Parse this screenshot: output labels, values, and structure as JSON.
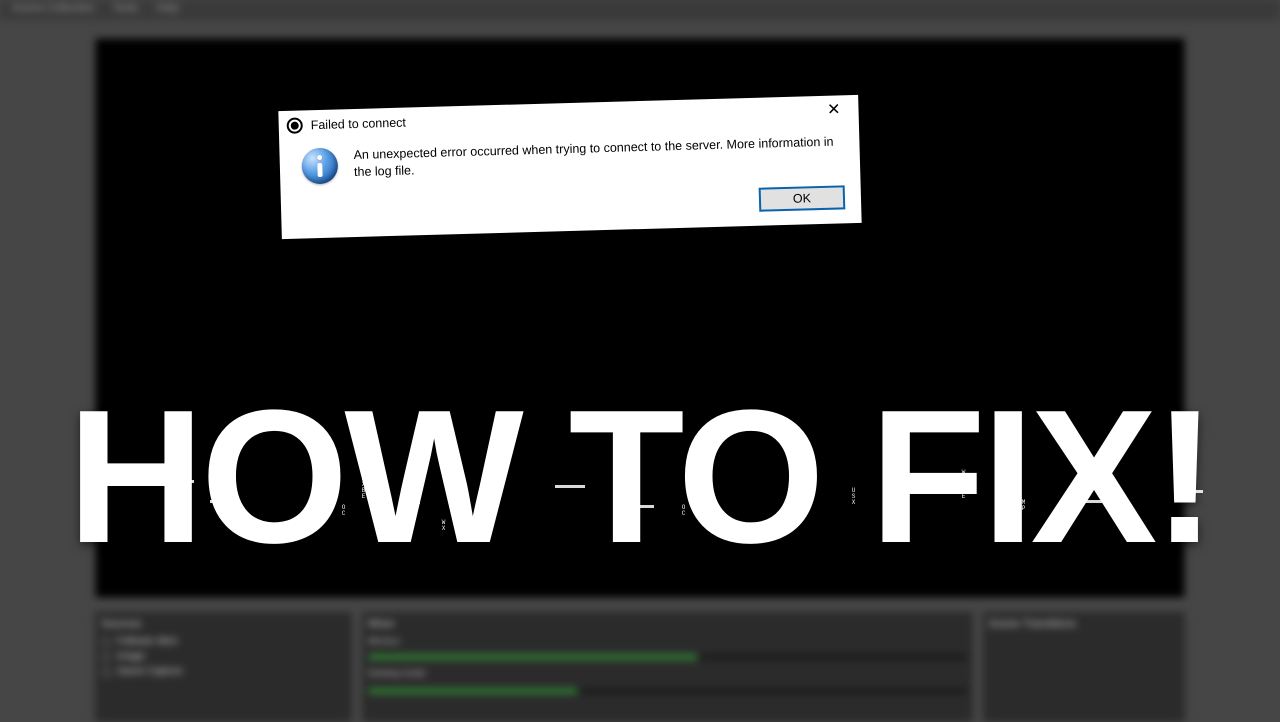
{
  "menubar": {
    "items": [
      "Scene Collection",
      "Tools",
      "Help"
    ]
  },
  "dialog": {
    "title": "Failed to connect",
    "message": "An unexpected error occurred when trying to connect to the server.  More information in the log file.",
    "ok_label": "OK"
  },
  "headline": "HOW TO FIX!",
  "panels": {
    "sources_label": "Sources",
    "mixer_label": "Mixer",
    "transitions_label": "Scene Transitions",
    "sources": [
      "Follower Alert",
      "Image",
      "Game Capture"
    ],
    "mixer_tracks": [
      "Mic/Aux",
      "Desktop Audio"
    ]
  },
  "noise_chars": "WMXBEOCHZAVURFGHWXUSXMP"
}
